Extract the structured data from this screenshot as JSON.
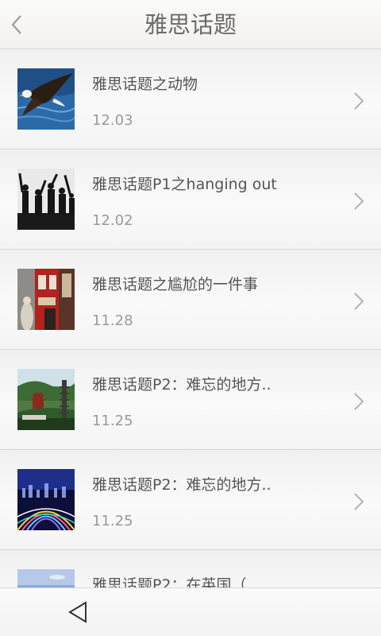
{
  "header": {
    "title": "雅思话题"
  },
  "articles": [
    {
      "title": "雅思话题之动物",
      "date": "12.03",
      "thumbnail": "eagle-photo"
    },
    {
      "title": "雅思话题P1之hanging out",
      "date": "12.02",
      "thumbnail": "silhouette-crowd-photo"
    },
    {
      "title": "雅思话题之尴尬的一件事",
      "date": "11.28",
      "thumbnail": "street-scene-photo"
    },
    {
      "title": "雅思话题P2：难忘的地方..",
      "date": "11.25",
      "thumbnail": "pagoda-photo"
    },
    {
      "title": "雅思话题P2：难忘的地方..",
      "date": "11.25",
      "thumbnail": "city-lights-photo"
    },
    {
      "title": "雅思话题P2：在英国（",
      "date": "",
      "thumbnail": "sky-photo"
    }
  ],
  "navbar": {
    "back_icon": "triangle-back-icon"
  }
}
